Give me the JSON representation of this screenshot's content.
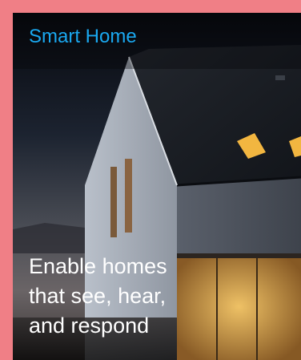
{
  "card": {
    "title": "Smart Home",
    "caption_lines": [
      "Enable homes",
      "that see, hear,",
      "and respond"
    ],
    "image": "modern-house-at-dusk"
  },
  "colors": {
    "frame": "#f07f86",
    "title": "#1aa8f0",
    "caption": "#ffffff",
    "window_light": "#f2b640"
  }
}
